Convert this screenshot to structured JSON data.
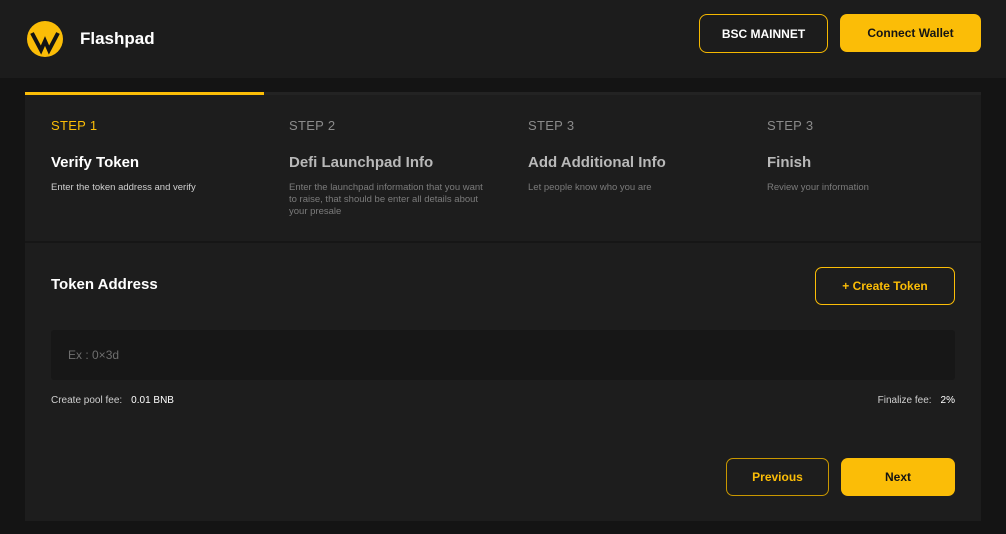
{
  "header": {
    "brand": "Flashpad",
    "logo_icon": "lightning-bolt-logo-icon",
    "network_label": "BSC MAINNET",
    "connect_label": "Connect Wallet"
  },
  "steps": {
    "current_step": 1,
    "total_steps": 4,
    "items": [
      {
        "number": "STEP 1",
        "title": "Verify Token",
        "description": "Enter the token address and verify",
        "active": true
      },
      {
        "number": "STEP 2",
        "title": "Defi Launchpad Info",
        "description": "Enter the launchpad information that you want to raise, that should be enter all details about your presale",
        "active": false
      },
      {
        "number": "STEP 3",
        "title": "Add Additional Info",
        "description": "Let people know who you are",
        "active": false
      },
      {
        "number": "STEP 3",
        "title": "Finish",
        "description": "Review your information",
        "active": false
      }
    ]
  },
  "token_section": {
    "title": "Token Address",
    "create_token_label": "+ Create Token",
    "input_value": "",
    "input_placeholder": "Ex : 0×3d"
  },
  "fees": {
    "create_pool_label": "Create pool fee:",
    "create_pool_value": "0.01 BNB",
    "finalize_label": "Finalize fee:",
    "finalize_value": "2%"
  },
  "actions": {
    "previous_label": "Previous",
    "next_label": "Next"
  },
  "colors": {
    "accent": "#fbbd07",
    "background": "#141414",
    "surface": "#1d1d1d",
    "topbar": "#1c1c1c"
  }
}
